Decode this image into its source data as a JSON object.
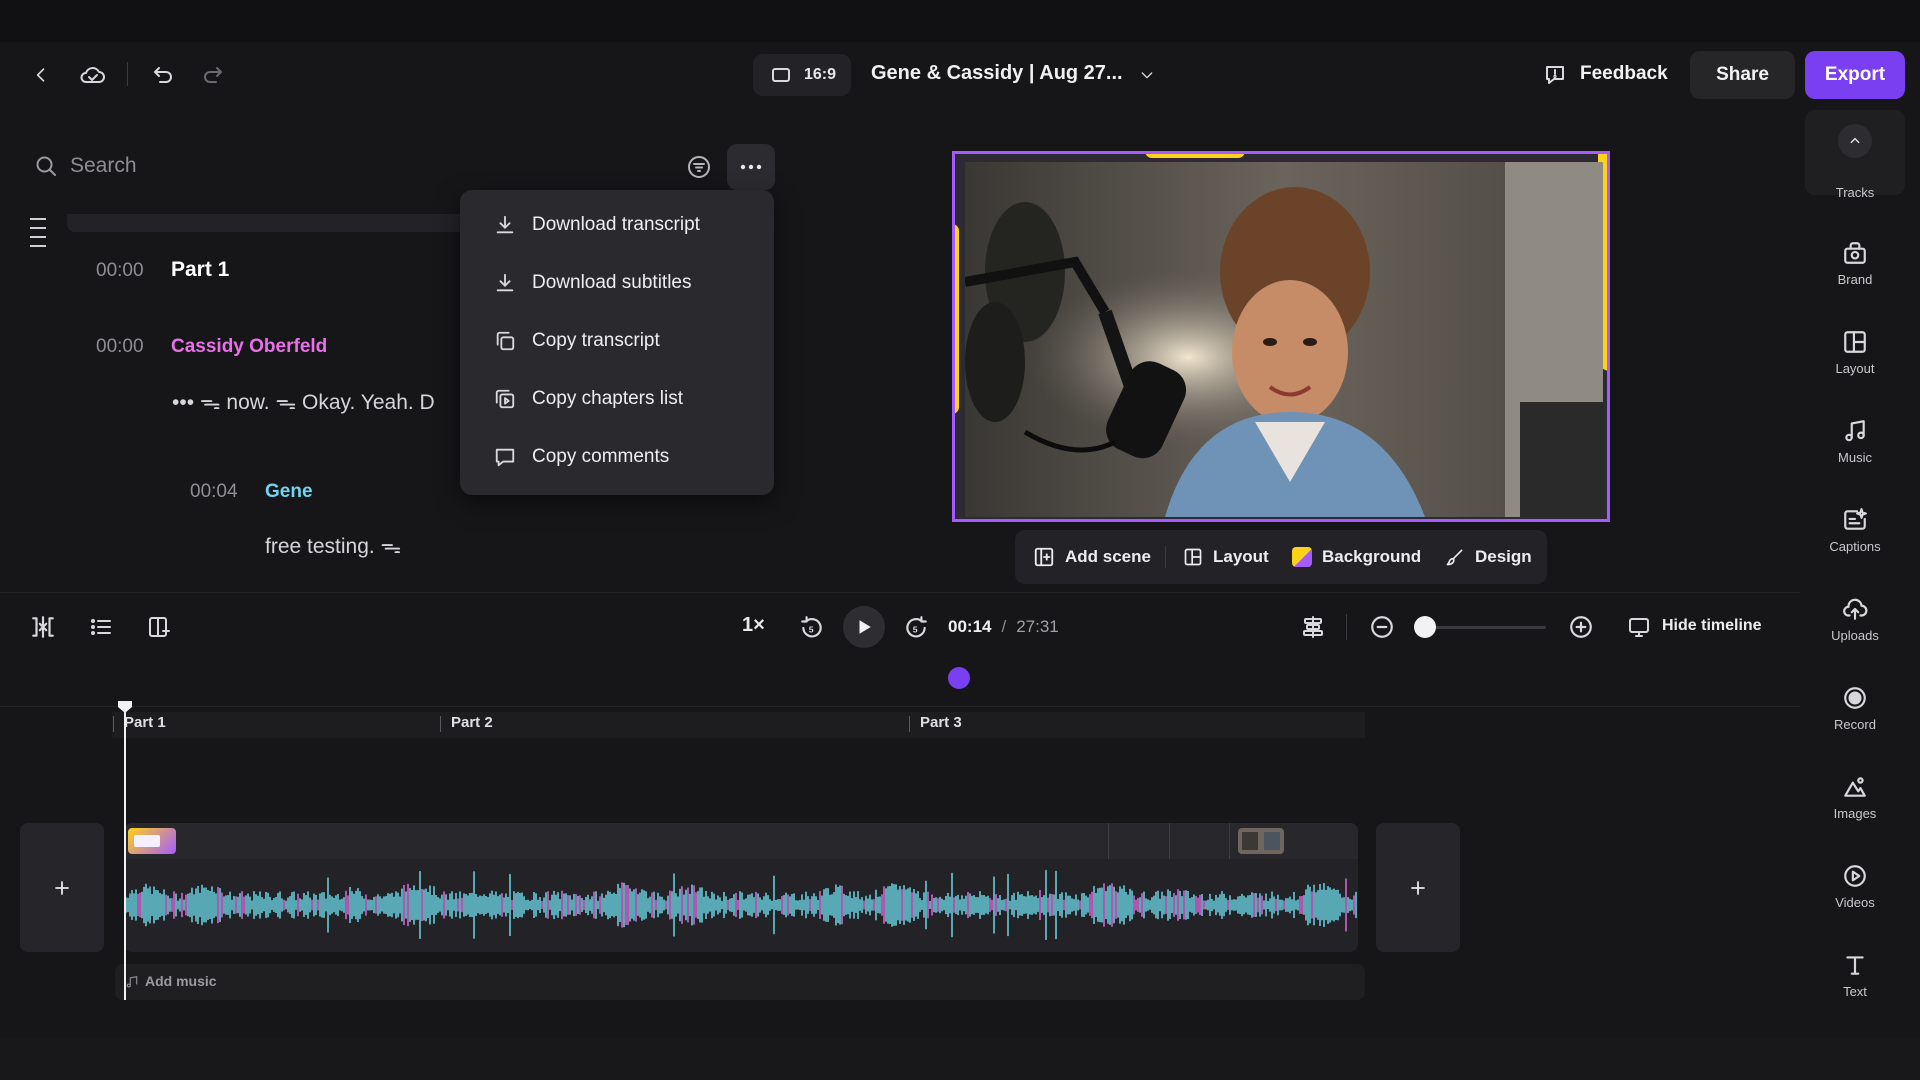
{
  "header": {
    "aspect_ratio": "16:9",
    "project_title": "Gene & Cassidy | Aug 27...",
    "feedback_label": "Feedback",
    "share_label": "Share",
    "export_label": "Export",
    "export_color": "#7b3ff2"
  },
  "transcript": {
    "search_placeholder": "Search",
    "part_time": "00:00",
    "part_title": "Part 1",
    "segments": [
      {
        "time": "00:00",
        "speaker": "Cassidy Oberfeld",
        "text": "••• ᯓ now. ᯓ Okay. Yeah. D"
      },
      {
        "time": "00:04",
        "speaker": "Gene",
        "text": "free testing. ᯓ"
      }
    ]
  },
  "menu": {
    "items": [
      {
        "label": "Download transcript",
        "icon": "download-icon"
      },
      {
        "label": "Download subtitles",
        "icon": "download-icon"
      },
      {
        "label": "Copy transcript",
        "icon": "copy-icon"
      },
      {
        "label": "Copy chapters list",
        "icon": "copy-chapters-icon"
      },
      {
        "label": "Copy comments",
        "icon": "comment-icon"
      }
    ]
  },
  "preview_toolbar": {
    "add_scene": "Add scene",
    "layout": "Layout",
    "background": "Background",
    "design": "Design"
  },
  "playback": {
    "speed": "1×",
    "current_time": "00:14",
    "separator": "/",
    "total_time": "27:31",
    "hide_timeline": "Hide timeline",
    "zoom_level": 0.0
  },
  "timeline": {
    "chapters": [
      "Part 1",
      "Part 2",
      "Part 3"
    ],
    "add_music": "Add music"
  },
  "rail": {
    "items": [
      {
        "label": "Tracks",
        "icon": "tracks-icon"
      },
      {
        "label": "Brand",
        "icon": "brand-icon"
      },
      {
        "label": "Layout",
        "icon": "layout-icon"
      },
      {
        "label": "Music",
        "icon": "music-icon"
      },
      {
        "label": "Captions",
        "icon": "captions-icon"
      },
      {
        "label": "Uploads",
        "icon": "upload-icon"
      },
      {
        "label": "Record",
        "icon": "record-icon"
      },
      {
        "label": "Images",
        "icon": "images-icon"
      },
      {
        "label": "Videos",
        "icon": "videos-icon"
      },
      {
        "label": "Text",
        "icon": "text-icon"
      }
    ]
  },
  "colors": {
    "accent_purple": "#a55bff",
    "accent_yellow": "#ffd21a",
    "speaker_pink": "#e870e8",
    "speaker_cyan": "#6fd5f0"
  }
}
